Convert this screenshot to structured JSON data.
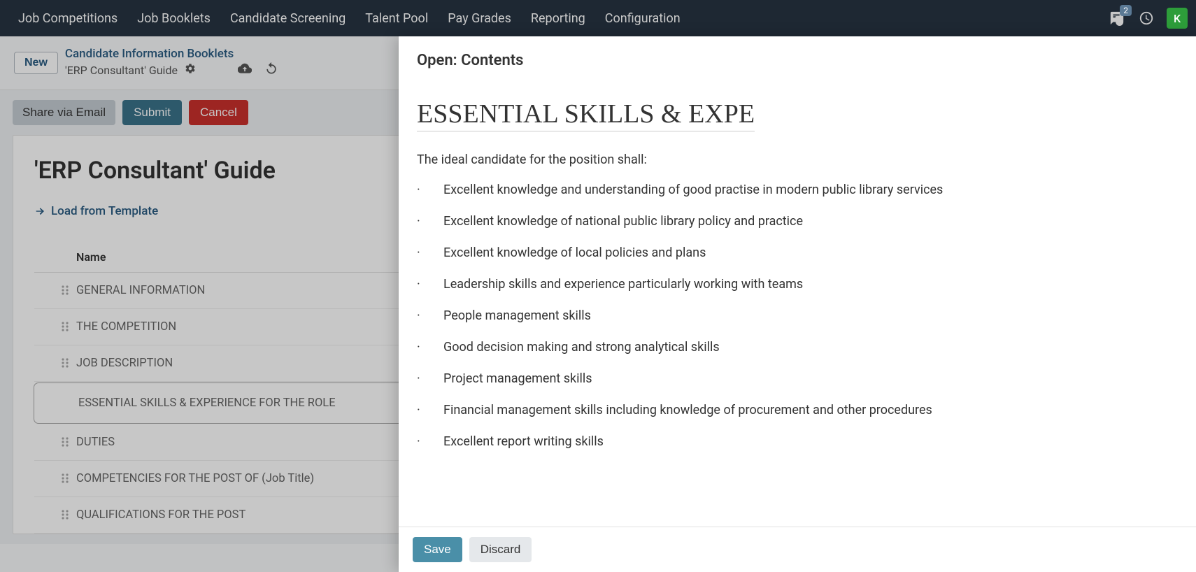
{
  "nav": {
    "items": [
      "Job Competitions",
      "Job Booklets",
      "Candidate Screening",
      "Talent Pool",
      "Pay Grades",
      "Reporting",
      "Configuration"
    ],
    "messages_badge": "2",
    "avatar": "K"
  },
  "breadcrumb": {
    "new_label": "New",
    "parent": "Candidate Information Booklets",
    "current": "'ERP Consultant' Guide"
  },
  "actions": {
    "share": "Share via Email",
    "submit": "Submit",
    "cancel": "Cancel"
  },
  "card": {
    "title": "'ERP Consultant' Guide",
    "load_template": "Load from Template",
    "col_name": "Name",
    "rows": [
      "GENERAL INFORMATION",
      "THE COMPETITION",
      "JOB DESCRIPTION",
      "ESSENTIAL SKILLS & EXPERIENCE FOR THE ROLE",
      "DUTIES",
      "COMPETENCIES FOR THE POST OF (Job Title)",
      "QUALIFICATIONS FOR THE POST"
    ],
    "selected_index": 3
  },
  "panel": {
    "header": "Open: Contents",
    "heading": "ESSENTIAL SKILLS & EXPE",
    "intro": "The ideal candidate for the position shall:",
    "bullets": [
      "Excellent knowledge and understanding of good practise in modern public library services",
      "Excellent knowledge of national public library policy and practice",
      "Excellent knowledge of local policies and plans",
      "Leadership skills and experience particularly working with teams",
      "People management skills",
      "Good decision making and strong analytical skills",
      "Project management skills",
      "Financial management skills including knowledge of procurement and other procedures",
      "Excellent report writing skills"
    ],
    "save": "Save",
    "discard": "Discard"
  }
}
